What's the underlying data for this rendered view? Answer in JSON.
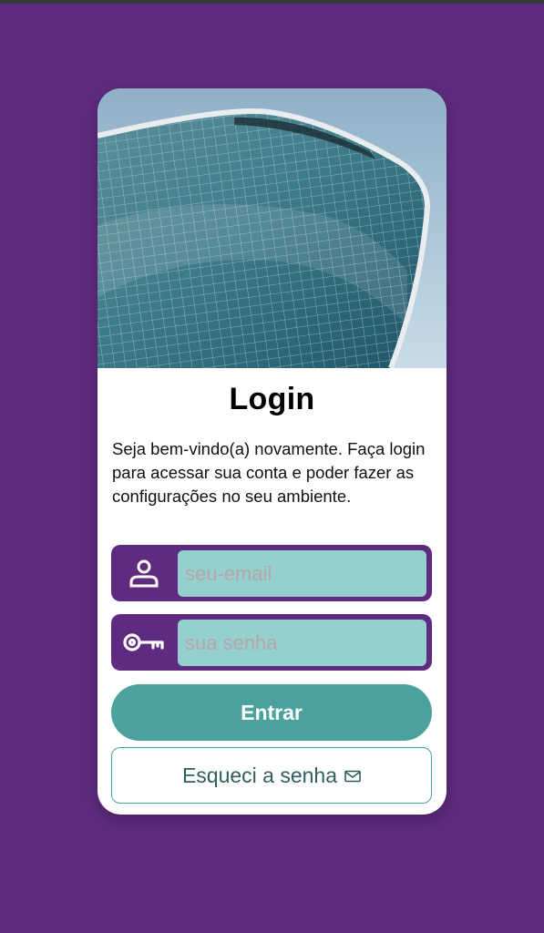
{
  "colors": {
    "background": "#5f2b80",
    "card": "#ffffff",
    "field_frame": "#5f2b80",
    "field_input": "#93d0ce",
    "placeholder": "#b9a4a9",
    "primary_button": "#4aa19e",
    "primary_button_text": "#ffffff",
    "secondary_border": "#4aa19e",
    "secondary_text": "#2f5f5e"
  },
  "hero": {
    "image": "glass-skyscraper-photo"
  },
  "login": {
    "title": "Login",
    "description": "Seja bem-vindo(a) novamente. Faça login para acessar sua conta e poder fazer as configurações no seu ambiente."
  },
  "email": {
    "icon": "user-icon",
    "placeholder": "seu-email",
    "value": ""
  },
  "password": {
    "icon": "key-icon",
    "placeholder": "sua senha",
    "value": ""
  },
  "actions": {
    "submit_label": "Entrar",
    "forgot_label": "Esqueci a senha",
    "forgot_icon": "mail-icon"
  }
}
